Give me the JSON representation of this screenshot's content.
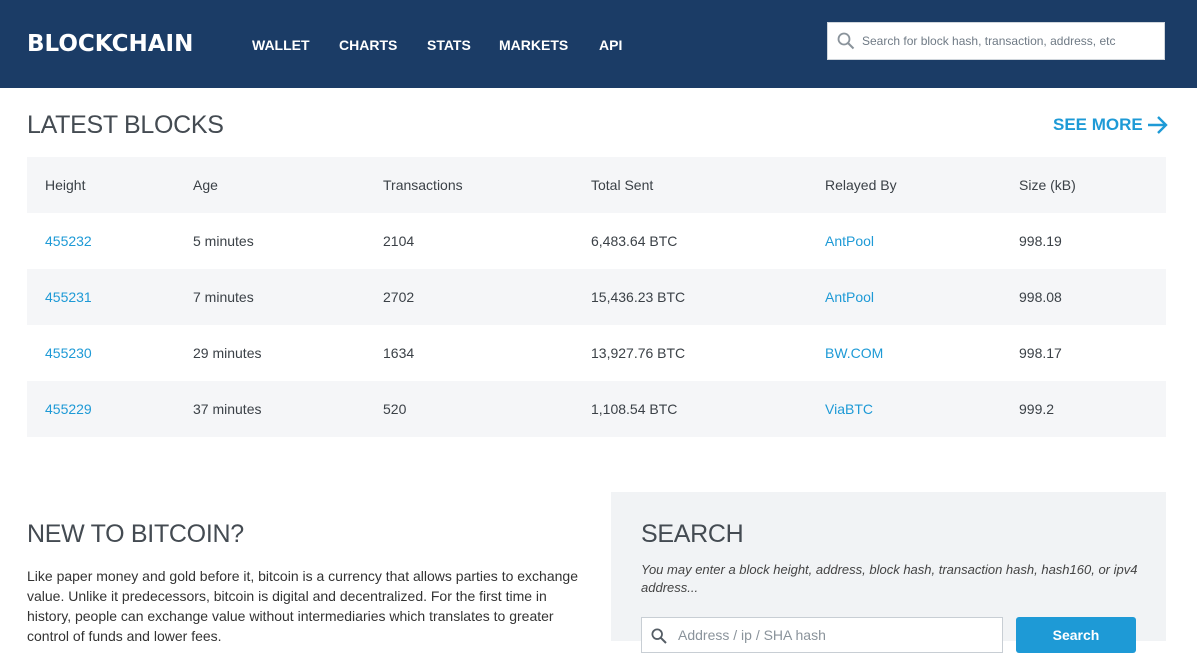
{
  "header": {
    "logo": "BLOCKCHAIN",
    "nav": [
      "WALLET",
      "CHARTS",
      "STATS",
      "MARKETS",
      "API"
    ],
    "search_placeholder": "Search for block hash, transaction, address, etc",
    "background_color": "#1b3c66"
  },
  "latest_blocks": {
    "title": "LATEST BLOCKS",
    "see_more": "SEE MORE",
    "columns": [
      "Height",
      "Age",
      "Transactions",
      "Total Sent",
      "Relayed By",
      "Size (kB)"
    ],
    "rows": [
      {
        "height": "455232",
        "age": "5 minutes",
        "transactions": "2104",
        "total_sent": "6,483.64 BTC",
        "relayed_by": "AntPool",
        "size": "998.19"
      },
      {
        "height": "455231",
        "age": "7 minutes",
        "transactions": "2702",
        "total_sent": "15,436.23 BTC",
        "relayed_by": "AntPool",
        "size": "998.08"
      },
      {
        "height": "455230",
        "age": "29 minutes",
        "transactions": "1634",
        "total_sent": "13,927.76 BTC",
        "relayed_by": "BW.COM",
        "size": "998.17"
      },
      {
        "height": "455229",
        "age": "37 minutes",
        "transactions": "520",
        "total_sent": "1,108.54 BTC",
        "relayed_by": "ViaBTC",
        "size": "999.2"
      }
    ]
  },
  "new_to_bitcoin": {
    "title": "NEW TO BITCOIN?",
    "text": "Like paper money and gold before it, bitcoin is a currency that allows parties to exchange value. Unlike it predecessors, bitcoin is digital and decentralized. For the first time in history, people can exchange value without intermediaries which translates to greater control of funds and lower fees."
  },
  "search_panel": {
    "title": "SEARCH",
    "hint": "You may enter a block height, address, block hash, transaction hash, hash160, or ipv4 address...",
    "input_placeholder": "Address / ip / SHA hash",
    "button": "Search"
  },
  "colors": {
    "accent": "#1e9ad6",
    "row_shade": "#f5f6f8",
    "panel": "#f1f3f5"
  },
  "icons": [
    "search-icon",
    "arrow-right-icon"
  ]
}
